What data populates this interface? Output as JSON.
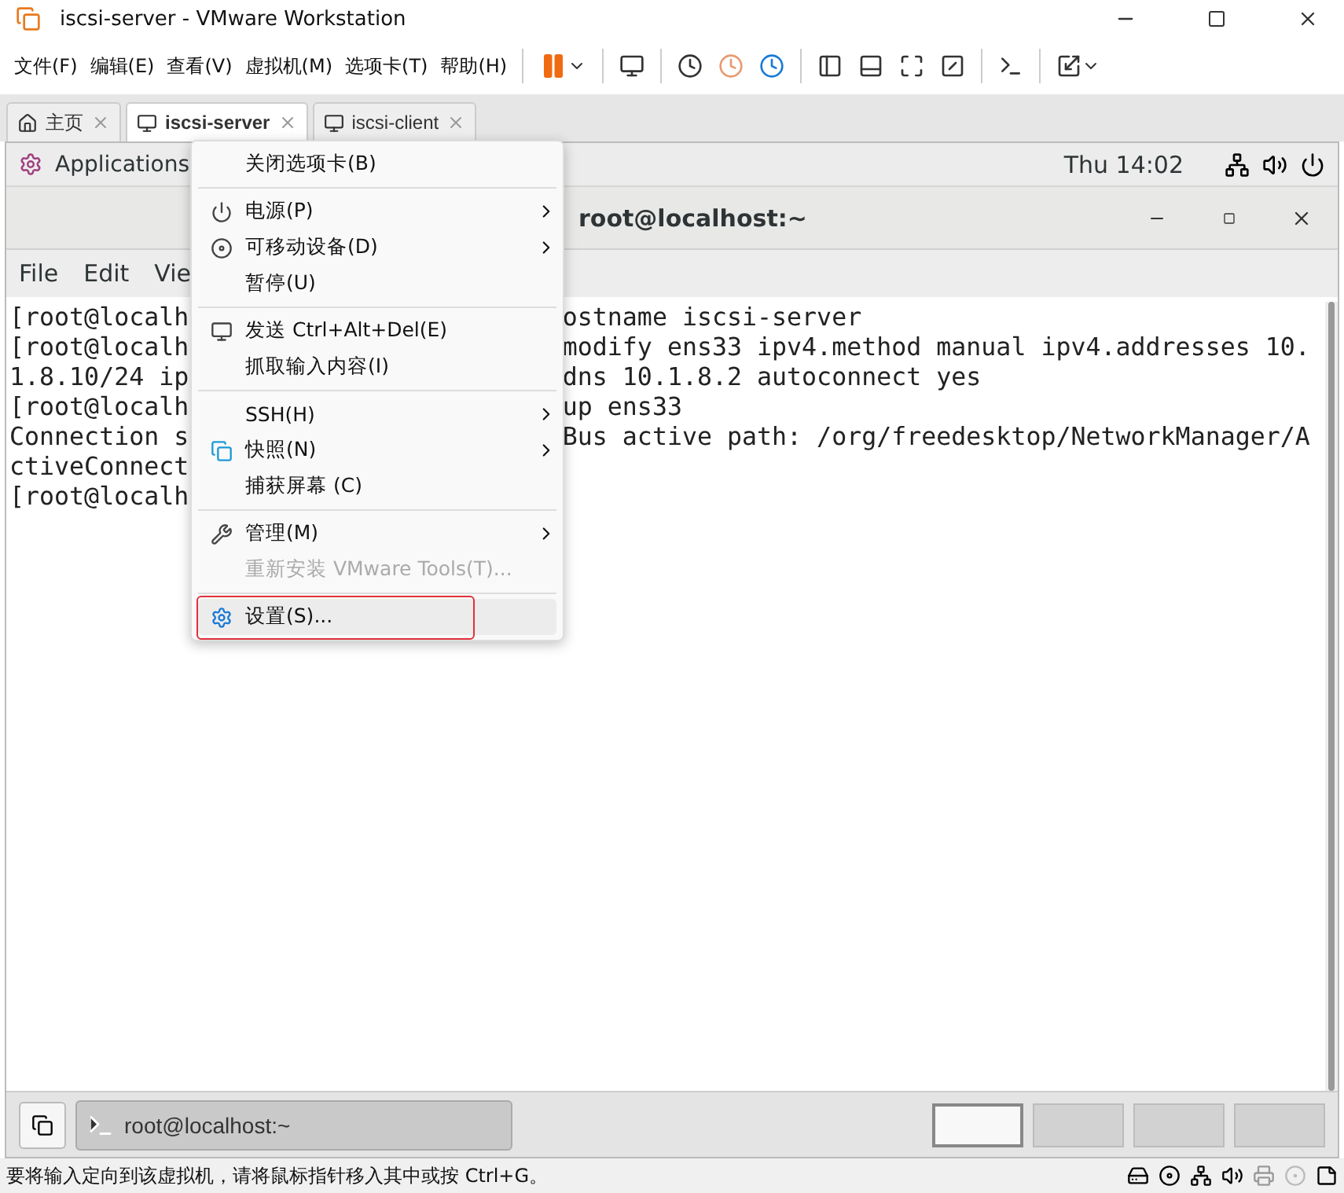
{
  "window": {
    "title": "iscsi-server - VMware Workstation"
  },
  "menubar": [
    "文件(F)",
    "编辑(E)",
    "查看(V)",
    "虚拟机(M)",
    "选项卡(T)",
    "帮助(H)"
  ],
  "tabs": [
    {
      "label": "主页",
      "selected": false
    },
    {
      "label": "iscsi-server",
      "selected": true
    },
    {
      "label": "iscsi-client",
      "selected": false
    }
  ],
  "guest": {
    "top_bar": {
      "applications": "Applications",
      "clock": "Thu 14:02"
    },
    "terminal": {
      "title": "root@localhost:~",
      "menu": [
        "File",
        "Edit",
        "Vie"
      ],
      "lines": [
        {
          "left": "[root@localh",
          "right": "ostname iscsi-server"
        },
        {
          "left": "[root@localh",
          "right": "modify ens33 ipv4.method manual ipv4.addresses 10."
        },
        {
          "left": "1.8.10/24 ip",
          "right": "dns 10.1.8.2 autoconnect yes"
        },
        {
          "left": "[root@localh",
          "right": "up ens33"
        },
        {
          "left": "Connection s",
          "right": "Bus active path: /org/freedesktop/NetworkManager/A"
        },
        {
          "left": "ctiveConnect"
        },
        {
          "left": "[root@localh"
        }
      ]
    },
    "taskbar": {
      "window": "root@localhost:~",
      "workspaces": [
        {
          "selected": true
        },
        {
          "selected": false
        },
        {
          "selected": false
        },
        {
          "selected": false
        }
      ]
    }
  },
  "context_menu": [
    {
      "kind": "item",
      "label": "关闭选项卡(B)",
      "submenu": false,
      "disabled": false,
      "selected": false
    },
    {
      "kind": "separator"
    },
    {
      "kind": "item",
      "label": "电源(P)",
      "submenu": true,
      "disabled": false,
      "selected": false
    },
    {
      "kind": "item",
      "label": "可移动设备(D)",
      "submenu": true,
      "disabled": false,
      "selected": false
    },
    {
      "kind": "item",
      "label": "暂停(U)",
      "submenu": false,
      "disabled": false,
      "selected": false
    },
    {
      "kind": "separator"
    },
    {
      "kind": "item",
      "label": "发送 Ctrl+Alt+Del(E)",
      "submenu": false,
      "disabled": false,
      "selected": false
    },
    {
      "kind": "item",
      "label": "抓取输入内容(I)",
      "submenu": false,
      "disabled": false,
      "selected": false
    },
    {
      "kind": "separator"
    },
    {
      "kind": "item",
      "label": "SSH(H)",
      "submenu": true,
      "disabled": false,
      "selected": false
    },
    {
      "kind": "item",
      "label": "快照(N)",
      "submenu": true,
      "disabled": false,
      "selected": false
    },
    {
      "kind": "item",
      "label": "捕获屏幕 (C)",
      "submenu": false,
      "disabled": false,
      "selected": false
    },
    {
      "kind": "separator"
    },
    {
      "kind": "item",
      "label": "管理(M)",
      "submenu": true,
      "disabled": false,
      "selected": false
    },
    {
      "kind": "item",
      "label": "重新安装 VMware Tools(T)...",
      "submenu": false,
      "disabled": true,
      "selected": false
    },
    {
      "kind": "separator"
    },
    {
      "kind": "item",
      "label": "设置(S)...",
      "submenu": false,
      "disabled": false,
      "selected": true
    }
  ],
  "status_bar": {
    "message": "要将输入定向到该虚拟机，请将鼠标指针移入其中或按 Ctrl+G。"
  }
}
